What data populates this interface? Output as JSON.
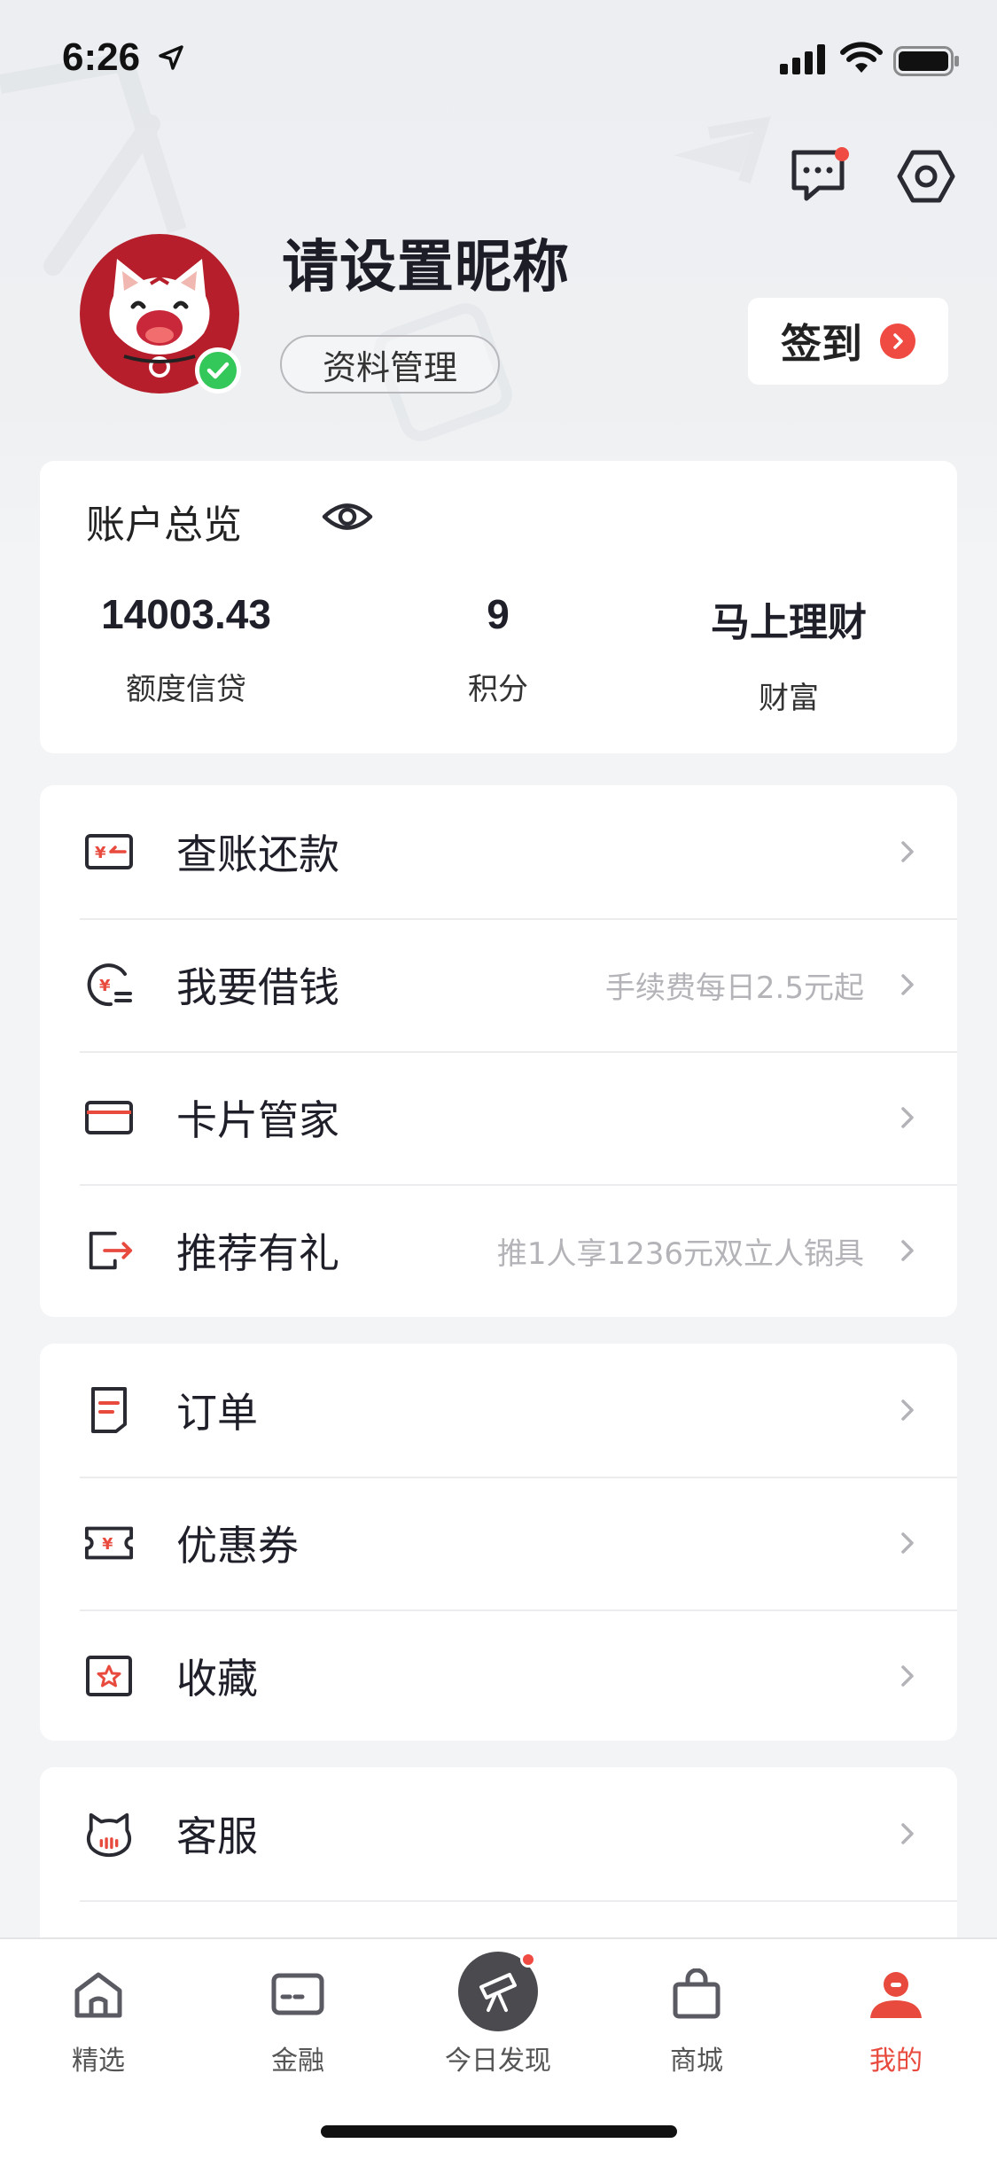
{
  "status_bar": {
    "time": "6:26"
  },
  "profile": {
    "nickname": "请设置昵称",
    "manage_label": "资料管理",
    "checkin_label": "签到"
  },
  "overview": {
    "title": "账户总览",
    "stats": [
      {
        "value": "14003.43",
        "label": "额度信贷"
      },
      {
        "value": "9",
        "label": "积分"
      },
      {
        "value": "马上理财",
        "label": "财富"
      }
    ]
  },
  "menu_group_1": [
    {
      "label": "查账还款",
      "hint": "",
      "icon": "bill-yen-icon"
    },
    {
      "label": "我要借钱",
      "hint": "手续费每日2.5元起",
      "icon": "borrow-money-icon"
    },
    {
      "label": "卡片管家",
      "hint": "",
      "icon": "card-icon"
    },
    {
      "label": "推荐有礼",
      "hint": "推1人享1236元双立人锅具",
      "icon": "share-exit-icon"
    }
  ],
  "menu_group_2": [
    {
      "label": "订单",
      "hint": "",
      "icon": "order-document-icon"
    },
    {
      "label": "优惠券",
      "hint": "",
      "icon": "coupon-icon"
    },
    {
      "label": "收藏",
      "hint": "",
      "icon": "favorite-star-icon"
    }
  ],
  "menu_group_3": [
    {
      "label": "客服",
      "hint": "",
      "icon": "customer-service-cat-icon"
    }
  ],
  "tab_bar": [
    {
      "label": "精选",
      "icon": "home-icon"
    },
    {
      "label": "金融",
      "icon": "finance-card-icon"
    },
    {
      "label": "今日发现",
      "icon": "telescope-icon"
    },
    {
      "label": "商城",
      "icon": "shopping-bag-icon"
    },
    {
      "label": "我的",
      "icon": "profile-user-icon",
      "active": true
    }
  ],
  "colors": {
    "accent": "#e84a3e",
    "avatar_bg": "#b51e2a",
    "verify": "#34c759"
  }
}
